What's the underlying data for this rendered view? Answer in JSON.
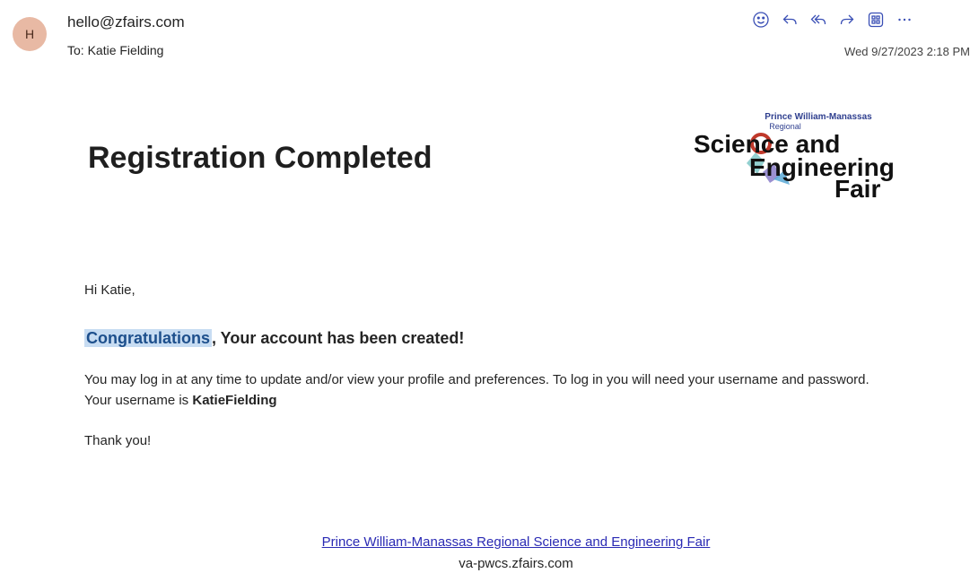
{
  "header": {
    "avatar_initial": "H",
    "sender": "hello@zfairs.com",
    "to": "To: Katie Fielding",
    "date": "Wed 9/27/2023 2:18 PM"
  },
  "toolbar": {
    "icons": [
      "emoji-icon",
      "reply-icon",
      "reply-all-icon",
      "forward-icon",
      "apps-icon",
      "more-icon"
    ]
  },
  "email": {
    "title": "Registration Completed",
    "logo": {
      "line1": "Prince William-Manassas",
      "line2": "Regional",
      "line3": "Science and",
      "line4": "Engineering",
      "line5": "Fair"
    },
    "greeting": "Hi Katie,",
    "headline_highlight": "Congratulations",
    "headline_rest": ", Your account has been created!",
    "body_before_username": "You may log in at any time to update and/or view your profile and preferences. To log in you will need your username and password. Your username is ",
    "username": "KatieFielding",
    "thanks": "Thank you!",
    "footer_link": "Prince William-Manassas Regional Science and Engineering Fair",
    "footer_url": "va-pwcs.zfairs.com"
  },
  "colors": {
    "accent": "#3a4fb5",
    "highlight": "#c7dcf2",
    "link": "#2a2ab4"
  }
}
